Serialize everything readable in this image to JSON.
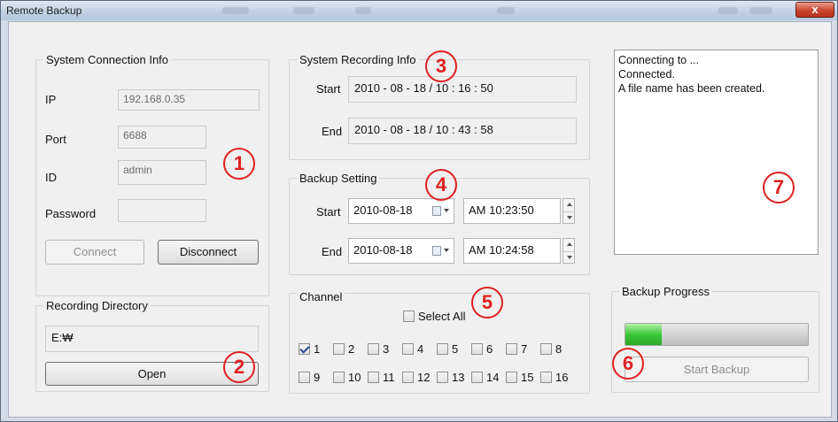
{
  "window": {
    "title": "Remote Backup",
    "close": "x"
  },
  "connection": {
    "title": "System Connection Info",
    "ip_label": "IP",
    "ip_value": "192.168.0.35",
    "port_label": "Port",
    "port_value": "6688",
    "id_label": "ID",
    "id_value": "admin",
    "password_label": "Password",
    "password_value": "",
    "connect_label": "Connect",
    "disconnect_label": "Disconnect"
  },
  "directory": {
    "title": "Recording Directory",
    "path": "E:₩",
    "open_label": "Open"
  },
  "recording_info": {
    "title": "System Recording Info",
    "start_label": "Start",
    "start_value": "2010 - 08 - 18  /  10 : 16 : 50",
    "end_label": "End",
    "end_value": "2010 - 08 - 18  /  10 : 43 : 58"
  },
  "backup_setting": {
    "title": "Backup Setting",
    "start_label": "Start",
    "start_date": "2010-08-18",
    "start_time": "AM 10:23:50",
    "end_label": "End",
    "end_date": "2010-08-18",
    "end_time": "AM 10:24:58"
  },
  "channel": {
    "title": "Channel",
    "select_all_label": "Select All",
    "select_all_checked": false,
    "items": [
      {
        "label": "1",
        "checked": true
      },
      {
        "label": "2",
        "checked": false
      },
      {
        "label": "3",
        "checked": false
      },
      {
        "label": "4",
        "checked": false
      },
      {
        "label": "5",
        "checked": false
      },
      {
        "label": "6",
        "checked": false
      },
      {
        "label": "7",
        "checked": false
      },
      {
        "label": "8",
        "checked": false
      },
      {
        "label": "9",
        "checked": false
      },
      {
        "label": "10",
        "checked": false
      },
      {
        "label": "11",
        "checked": false
      },
      {
        "label": "12",
        "checked": false
      },
      {
        "label": "13",
        "checked": false
      },
      {
        "label": "14",
        "checked": false
      },
      {
        "label": "15",
        "checked": false
      },
      {
        "label": "16",
        "checked": false
      }
    ]
  },
  "log": {
    "lines": [
      "Connecting to ...",
      "Connected.",
      "A file name has been created."
    ]
  },
  "progress": {
    "title": "Backup Progress",
    "fraction": 0.2,
    "start_label": "Start Backup"
  },
  "markers": [
    "1",
    "2",
    "3",
    "4",
    "5",
    "6",
    "7"
  ],
  "colors": {
    "marker": "#e02020",
    "progress_fill": "#3cc83a"
  }
}
